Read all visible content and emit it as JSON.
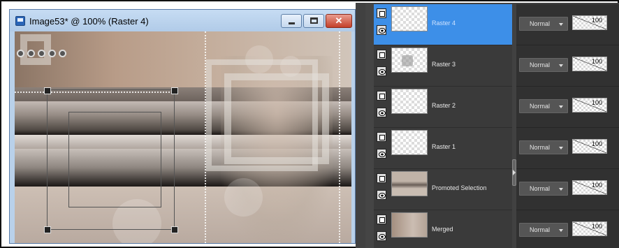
{
  "image_window": {
    "title": "Image53* @ 100% (Raster 4)",
    "minimize_glyph": "",
    "maximize_glyph": "",
    "close_glyph": "✕"
  },
  "layers": [
    {
      "name": "Raster 4",
      "blend_mode": "Normal",
      "opacity": "100",
      "selected": true
    },
    {
      "name": "Raster 3",
      "blend_mode": "Normal",
      "opacity": "100",
      "selected": false
    },
    {
      "name": "Raster 2",
      "blend_mode": "Normal",
      "opacity": "100",
      "selected": false
    },
    {
      "name": "Raster 1",
      "blend_mode": "Normal",
      "opacity": "100",
      "selected": false
    },
    {
      "name": "Promoted Selection",
      "blend_mode": "Normal",
      "opacity": "100",
      "selected": false
    },
    {
      "name": "Merged",
      "blend_mode": "Normal",
      "opacity": "100",
      "selected": false
    }
  ],
  "colors": {
    "selected_layer": "#3d8fe8",
    "palette_bg": "#414141",
    "titlebar": "#b9d1ea"
  }
}
